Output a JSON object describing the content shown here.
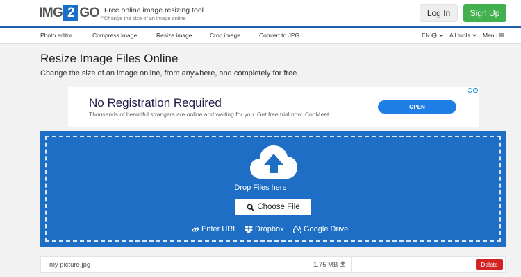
{
  "brand": {
    "logo_left": "IMG",
    "logo_two": "2",
    "logo_right": "GO",
    "logo_suffix": ".com",
    "tagline": "Free online image resizing tool",
    "tagline_sub": "Change the size of an image online"
  },
  "header": {
    "login_label": "Log In",
    "signup_label": "Sign Up"
  },
  "nav": {
    "items": [
      "Photo editor",
      "Compress image",
      "Resize image",
      "Crop image",
      "Convert to JPG"
    ],
    "language": "EN",
    "all_tools": "All tools",
    "menu": "Menu"
  },
  "page": {
    "title": "Resize Image Files Online",
    "subtitle": "Change the size of an image online, from anywhere, and completely for free."
  },
  "ad": {
    "headline": "No Registration Required",
    "body": "Thousands of beautiful strangers are online and waiting for you. Get free trial now. CooMeet",
    "cta": "OPEN"
  },
  "upload": {
    "drop_text": "Drop Files here",
    "choose_label": "Choose File",
    "url_label": "Enter URL",
    "dropbox_label": "Dropbox",
    "gdrive_label": "Google Drive"
  },
  "file": {
    "name": "my picture.jpg",
    "size": "1.75 MB",
    "delete_label": "Delete"
  },
  "colors": {
    "brand_blue": "#1d6ec4",
    "signup_green": "#42b04f",
    "delete_red": "#d22424"
  }
}
